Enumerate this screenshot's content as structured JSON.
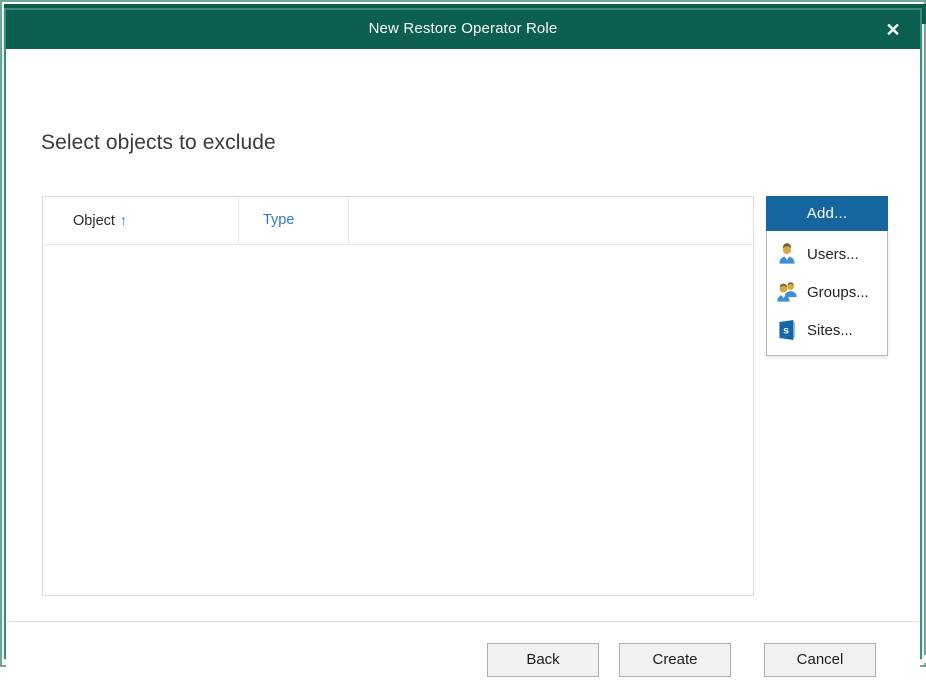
{
  "background_window": {
    "title": "New Restore Operator Role",
    "close_icon": "close-icon"
  },
  "dialog": {
    "title": "New Restore Operator Role",
    "close_icon": "close-icon",
    "heading": "Select objects to exclude"
  },
  "objects_list": {
    "columns": [
      {
        "label": "Object",
        "sort_indicator": "↑",
        "sorted": true
      },
      {
        "label": "Type",
        "sort_indicator": "",
        "sorted": false
      },
      {
        "label": "",
        "sort_indicator": "",
        "sorted": false
      }
    ],
    "rows": [],
    "empty": true
  },
  "add_control": {
    "button_label": "Add...",
    "button_color": "#15659f",
    "menu_open": true,
    "menu_items": [
      {
        "label": "Users...",
        "icon": "user-icon"
      },
      {
        "label": "Groups...",
        "icon": "users-group-icon"
      },
      {
        "label": "Sites...",
        "icon": "sharepoint-site-icon"
      }
    ]
  },
  "footer": {
    "back_label": "Back",
    "create_label": "Create",
    "cancel_label": "Cancel"
  },
  "colors": {
    "titlebar": "#0a5f4e",
    "dialog_border": "#3f8d7d",
    "accent_blue": "#15659f",
    "link_blue": "#2a7bc8"
  }
}
